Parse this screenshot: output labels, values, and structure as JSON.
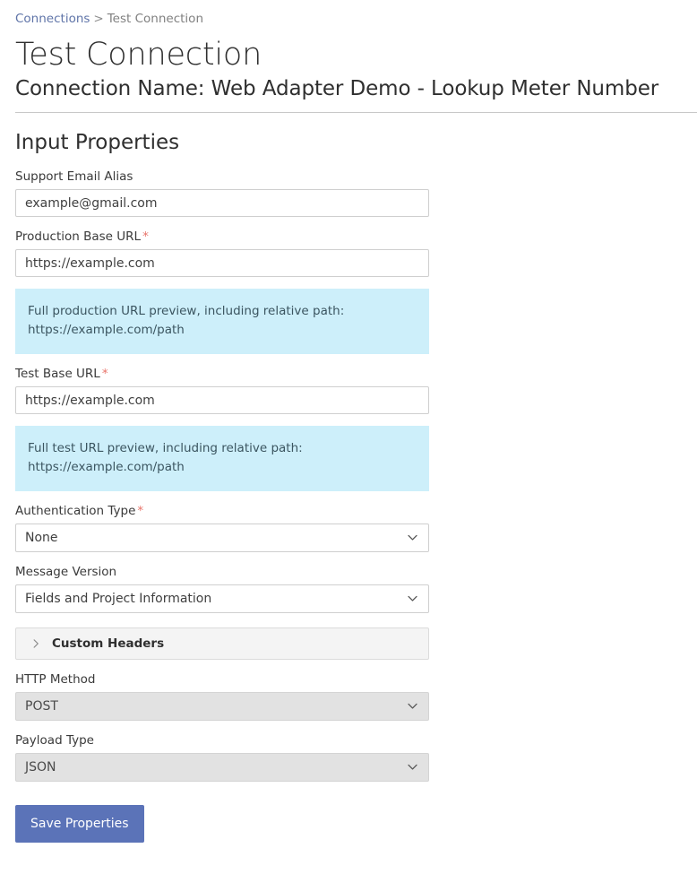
{
  "breadcrumb": {
    "parent_label": "Connections",
    "separator": ">",
    "current_label": "Test Connection"
  },
  "header": {
    "title": "Test Connection",
    "subtitle": "Connection Name: Web Adapter Demo - Lookup Meter Number"
  },
  "section": {
    "title": "Input Properties"
  },
  "fields": {
    "support_email": {
      "label": "Support Email Alias",
      "value": "example@gmail.com",
      "placeholder": "example@gmail.com",
      "required_marker": ""
    },
    "production_base_url": {
      "label": "Production Base URL",
      "value": "https://example.com",
      "placeholder": "https://example.com",
      "required_marker": "*"
    },
    "production_preview": {
      "line1": "Full production URL preview, including relative path:",
      "line2": "https://example.com/path"
    },
    "test_base_url": {
      "label": "Test Base URL",
      "value": "https://example.com",
      "placeholder": "https://example.com",
      "required_marker": "*"
    },
    "test_preview": {
      "line1": "Full test URL preview, including relative path:",
      "line2": "https://example.com/path"
    },
    "authentication_type": {
      "label": "Authentication Type",
      "value": "None",
      "required_marker": "*"
    },
    "message_version": {
      "label": "Message Version",
      "value": "Fields and Project Information",
      "required_marker": ""
    },
    "custom_headers": {
      "label": "Custom Headers"
    },
    "http_method": {
      "label": "HTTP Method",
      "value": "POST",
      "required_marker": ""
    },
    "payload_type": {
      "label": "Payload Type",
      "value": "JSON",
      "required_marker": ""
    }
  },
  "actions": {
    "save_label": "Save Properties"
  },
  "colors": {
    "link": "#5f74a8",
    "required_star": "#e8746a",
    "info_background": "#cdeffa",
    "info_text": "#3b5560",
    "primary_button": "#5b73b8",
    "disabled_field": "#e2e2e2"
  },
  "icons": {
    "chevron_down": "chevron-down-icon",
    "chevron_right": "chevron-right-icon"
  }
}
